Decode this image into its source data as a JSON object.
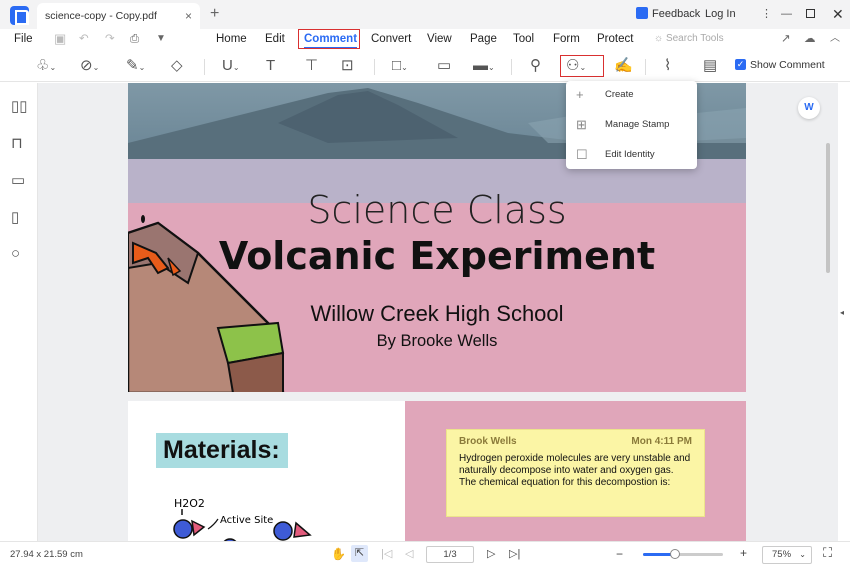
{
  "titlebar": {
    "tab_title": "science-copy - Copy.pdf",
    "close": "×",
    "new_tab": "+",
    "feedback": "Feedback",
    "login": "Log In"
  },
  "menu": {
    "file": "File",
    "items": [
      "Home",
      "Edit",
      "Comment",
      "Convert",
      "View",
      "Page",
      "Tool",
      "Form",
      "Protect"
    ],
    "active": "Comment",
    "search": "Search Tools"
  },
  "toolbar": {
    "show_comment": "Show Comment"
  },
  "stamp_menu": {
    "items": [
      "Create",
      "Manage Stamp",
      "Edit Identity"
    ]
  },
  "document": {
    "subtitle": "Science Class",
    "title": "Volcanic Experiment",
    "school": "Willow Creek High School",
    "author": "By Brooke Wells",
    "materials": "Materials:",
    "sketch_label_1": "H2O2",
    "sketch_label_2": "Active Site"
  },
  "note": {
    "author": "Brook Wells",
    "time": "Mon 4:11 PM",
    "text": "Hydrogen peroxide molecules are very unstable and naturally decompose into water and oxygen gas. The chemical equation for this decompostion is:"
  },
  "status": {
    "page_size": "27.94 x 21.59 cm",
    "page_indicator": "1/3",
    "zoom": "75%",
    "zoom_level": 0.4
  },
  "colors": {
    "accent": "#2b6bf3",
    "highlight": "#d93030",
    "page_pink": "#e0a6ba",
    "note_yellow": "#fbf5a5"
  }
}
